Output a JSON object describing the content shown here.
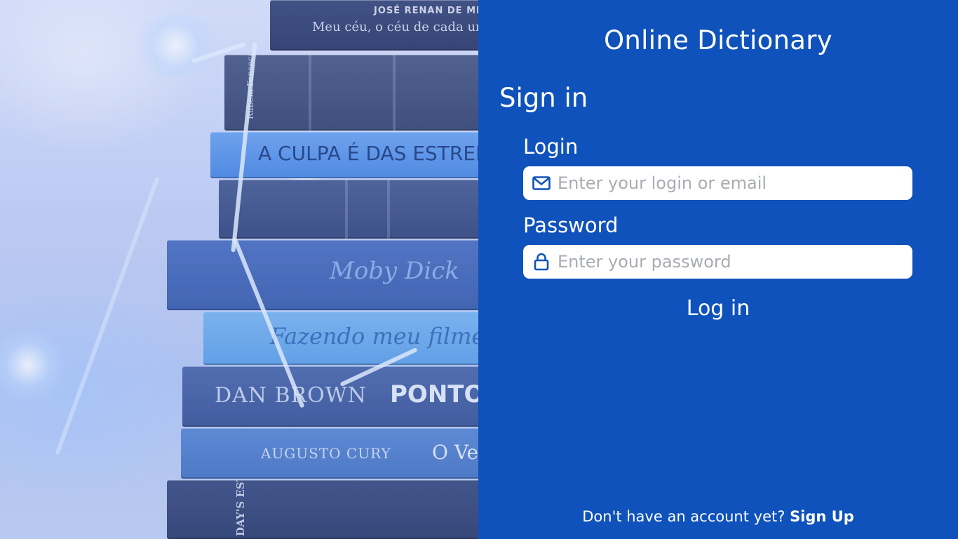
{
  "app": {
    "title": "Online Dictionary"
  },
  "form": {
    "heading": "Sign in",
    "login": {
      "label": "Login",
      "placeholder": "Enter your login or email",
      "value": "",
      "icon": "mail-icon"
    },
    "password": {
      "label": "Password",
      "placeholder": "Enter your password",
      "value": "",
      "icon": "lock-icon"
    },
    "submit_label": "Log in"
  },
  "footer": {
    "prompt": "Don't have an account yet?",
    "signup_label": "Sign Up"
  },
  "background_image": {
    "book_spines": [
      "JOSÉ RENAN DE ME",
      "Meu céu, o céu de cada um",
      "Rubem Fonseca",
      "A CULPA É DAS ESTRELAS",
      "Moby Dick",
      "Fazendo meu filme",
      "DAN BROWN",
      "PONTO DE",
      "AUGUSTO CURY",
      "O Ve",
      "DAY'S EST FICTION"
    ]
  },
  "colors": {
    "panel": "#0f52bb",
    "input_bg": "#ffffff",
    "placeholder": "#a8acb3",
    "icon": "#0f52bb"
  }
}
